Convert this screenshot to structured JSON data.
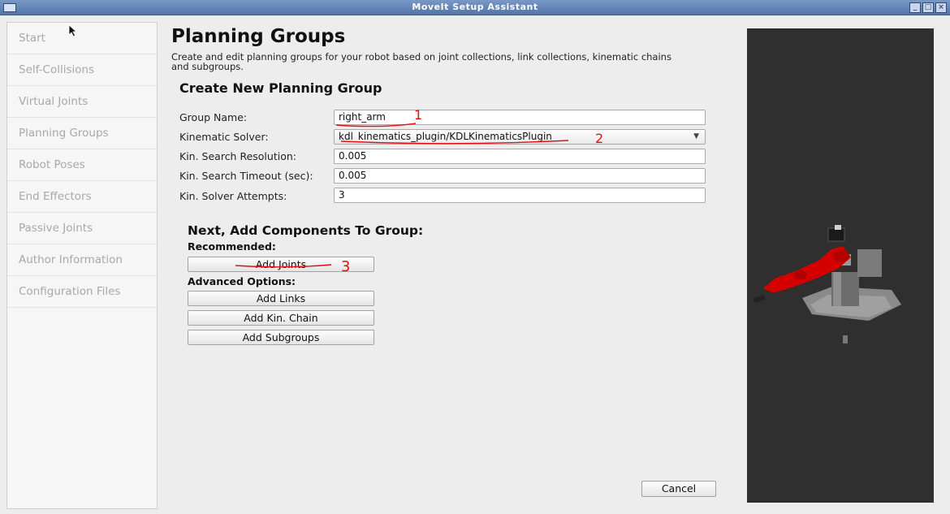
{
  "window": {
    "title": "MoveIt Setup Assistant"
  },
  "sidebar": {
    "items": [
      {
        "label": "Start"
      },
      {
        "label": "Self-Collisions"
      },
      {
        "label": "Virtual Joints"
      },
      {
        "label": "Planning Groups"
      },
      {
        "label": "Robot Poses"
      },
      {
        "label": "End Effectors"
      },
      {
        "label": "Passive Joints"
      },
      {
        "label": "Author Information"
      },
      {
        "label": "Configuration Files"
      }
    ]
  },
  "page": {
    "title": "Planning Groups",
    "description": "Create and edit planning groups for your robot based on joint collections, link collections, kinematic chains and subgroups.",
    "section_title": "Create New Planning Group"
  },
  "form": {
    "group_name": {
      "label": "Group Name:",
      "value": "right_arm"
    },
    "kinematic_solver": {
      "label": "Kinematic Solver:",
      "value": "kdl_kinematics_plugin/KDLKinematicsPlugin"
    },
    "search_resolution": {
      "label": "Kin. Search Resolution:",
      "value": "0.005"
    },
    "search_timeout": {
      "label": "Kin. Search Timeout (sec):",
      "value": "0.005"
    },
    "solver_attempts": {
      "label": "Kin. Solver Attempts:",
      "value": "3"
    }
  },
  "components": {
    "title": "Next, Add Components To Group:",
    "recommended_label": "Recommended:",
    "add_joints": "Add Joints",
    "advanced_label": "Advanced Options:",
    "add_links": "Add Links",
    "add_kin_chain": "Add Kin. Chain",
    "add_subgroups": "Add Subgroups"
  },
  "footer": {
    "cancel_label": "Cancel"
  },
  "annotations": {
    "mark1": "1",
    "mark2": "2",
    "mark3": "3"
  },
  "colors": {
    "titlebar": "#5a7cb0",
    "robot_arm": "#d40000",
    "viewer_bg": "#2f2f2f",
    "annotation": "#e01010"
  }
}
